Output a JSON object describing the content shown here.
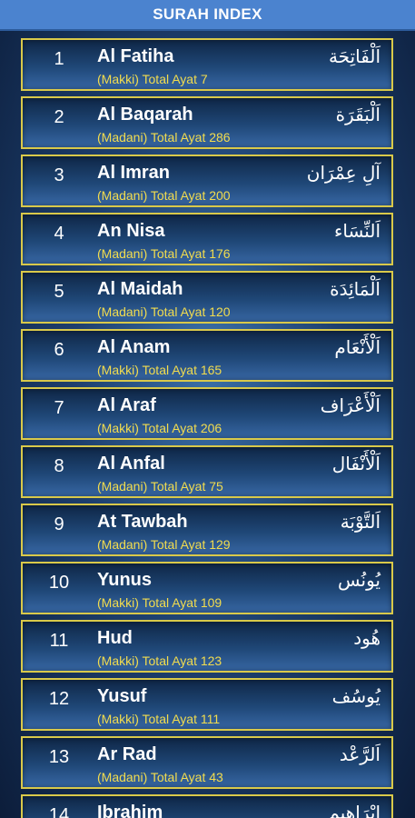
{
  "header": {
    "title": "SURAH INDEX"
  },
  "surahs": [
    {
      "number": "1",
      "name": "Al Fatiha",
      "info": "(Makki) Total Ayat 7",
      "arabic": "اَلْفَاتِحَة"
    },
    {
      "number": "2",
      "name": "Al Baqarah",
      "info": "(Madani) Total Ayat 286",
      "arabic": "اَلْبَقَرَة"
    },
    {
      "number": "3",
      "name": "Al Imran",
      "info": "(Madani) Total Ayat 200",
      "arabic": "آلِ عِمْرَان"
    },
    {
      "number": "4",
      "name": "An Nisa",
      "info": "(Madani) Total Ayat 176",
      "arabic": "اَلنِّسَاء"
    },
    {
      "number": "5",
      "name": "Al Maidah",
      "info": "(Madani) Total Ayat 120",
      "arabic": "اَلْمَائِدَة"
    },
    {
      "number": "6",
      "name": "Al Anam",
      "info": "(Makki) Total Ayat 165",
      "arabic": "اَلْأَنْعَام"
    },
    {
      "number": "7",
      "name": "Al Araf",
      "info": "(Makki) Total Ayat 206",
      "arabic": "اَلْأَعْرَاف"
    },
    {
      "number": "8",
      "name": "Al Anfal",
      "info": "(Madani) Total Ayat 75",
      "arabic": "اَلْأَنْفَال"
    },
    {
      "number": "9",
      "name": "At Tawbah",
      "info": "(Madani) Total Ayat 129",
      "arabic": "اَلتَّوْبَة"
    },
    {
      "number": "10",
      "name": "Yunus",
      "info": "(Makki) Total Ayat 109",
      "arabic": "يُونُس"
    },
    {
      "number": "11",
      "name": "Hud",
      "info": "(Makki) Total Ayat 123",
      "arabic": "هُود"
    },
    {
      "number": "12",
      "name": "Yusuf",
      "info": "(Makki) Total Ayat 111",
      "arabic": "يُوسُف"
    },
    {
      "number": "13",
      "name": "Ar Rad",
      "info": "(Madani) Total Ayat 43",
      "arabic": "اَلرَّعْد"
    },
    {
      "number": "14",
      "name": "Ibrahim",
      "info": "",
      "arabic": "إِبْرَاهِيم"
    }
  ]
}
